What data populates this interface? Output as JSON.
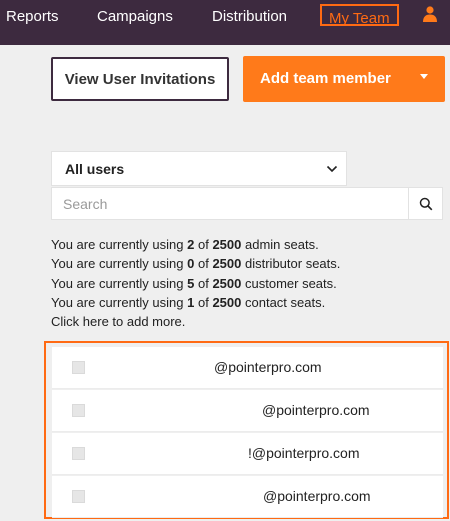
{
  "nav": {
    "items": [
      {
        "label": "Reports"
      },
      {
        "label": "Campaigns"
      },
      {
        "label": "Distribution"
      },
      {
        "label": "My Team"
      }
    ],
    "active": "My Team",
    "active_color": "#ff6a13",
    "user_icon": "user-icon"
  },
  "actions": {
    "invite_label": "View User Invitations",
    "add_label": "Add team member",
    "add_color": "#ff7a1a"
  },
  "filter": {
    "selected": "All users",
    "search_placeholder": "Search"
  },
  "seats": {
    "prefix": "You are currently using",
    "of": "of",
    "lines": [
      {
        "used": "2",
        "total": "2500",
        "kind": "admin seats."
      },
      {
        "used": "0",
        "total": "2500",
        "kind": "distributor seats."
      },
      {
        "used": "5",
        "total": "2500",
        "kind": "customer seats."
      },
      {
        "used": "1",
        "total": "2500",
        "kind": "contact seats."
      }
    ],
    "add_more": "Click here to add more."
  },
  "users": [
    {
      "email": "@pointerpro.com"
    },
    {
      "email": "@pointerpro.com"
    },
    {
      "email": "!@pointerpro.com"
    },
    {
      "email": "@pointerpro.com"
    }
  ]
}
